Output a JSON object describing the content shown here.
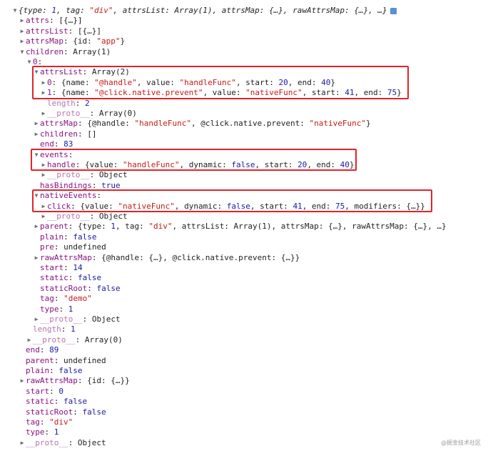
{
  "rows": [
    {
      "d": 0,
      "t": "d",
      "p": [
        {
          "c": "o it",
          "v": "{type: "
        },
        {
          "c": "n it",
          "v": "1"
        },
        {
          "c": "o it",
          "v": ", tag: "
        },
        {
          "c": "s it",
          "v": "\"div\""
        },
        {
          "c": "o it",
          "v": ", attrsList: Array(1), attrsMap: {…}, rawAttrsMap: {…}, …}"
        }
      ],
      "badge": true
    },
    {
      "d": 1,
      "t": "r",
      "p": [
        {
          "c": "k",
          "v": "attrs"
        },
        {
          "c": "p",
          "v": ": [{…}]"
        }
      ]
    },
    {
      "d": 1,
      "t": "r",
      "p": [
        {
          "c": "k",
          "v": "attrsList"
        },
        {
          "c": "p",
          "v": ": [{…}]"
        }
      ]
    },
    {
      "d": 1,
      "t": "r",
      "p": [
        {
          "c": "k",
          "v": "attrsMap"
        },
        {
          "c": "p",
          "v": ": {id: "
        },
        {
          "c": "s",
          "v": "\"app\""
        },
        {
          "c": "p",
          "v": "}"
        }
      ]
    },
    {
      "d": 1,
      "t": "d",
      "p": [
        {
          "c": "k",
          "v": "children"
        },
        {
          "c": "p",
          "v": ": Array(1)"
        }
      ]
    },
    {
      "d": 2,
      "t": "d",
      "p": [
        {
          "c": "k",
          "v": "0"
        },
        {
          "c": "p",
          "v": ":"
        }
      ]
    },
    {
      "d": 3,
      "t": "d",
      "p": [
        {
          "c": "k",
          "v": "attrsList"
        },
        {
          "c": "p",
          "v": ": Array(2)"
        }
      ]
    },
    {
      "d": 4,
      "t": "r",
      "p": [
        {
          "c": "k",
          "v": "0"
        },
        {
          "c": "p",
          "v": ": {name: "
        },
        {
          "c": "s",
          "v": "\"@handle\""
        },
        {
          "c": "p",
          "v": ", value: "
        },
        {
          "c": "s",
          "v": "\"handleFunc\""
        },
        {
          "c": "p",
          "v": ", start: "
        },
        {
          "c": "n",
          "v": "20"
        },
        {
          "c": "p",
          "v": ", end: "
        },
        {
          "c": "n",
          "v": "40"
        },
        {
          "c": "p",
          "v": "}"
        }
      ]
    },
    {
      "d": 4,
      "t": "r",
      "p": [
        {
          "c": "k",
          "v": "1"
        },
        {
          "c": "p",
          "v": ": {name: "
        },
        {
          "c": "s",
          "v": "\"@click.native.prevent\""
        },
        {
          "c": "p",
          "v": ", value: "
        },
        {
          "c": "s",
          "v": "\"nativeFunc\""
        },
        {
          "c": "p",
          "v": ", start: "
        },
        {
          "c": "n",
          "v": "41"
        },
        {
          "c": "p",
          "v": ", end: "
        },
        {
          "c": "n",
          "v": "75"
        },
        {
          "c": "p",
          "v": "}"
        }
      ]
    },
    {
      "d": 4,
      "t": "n",
      "p": [
        {
          "c": "k dim",
          "v": "length"
        },
        {
          "c": "p",
          "v": ": "
        },
        {
          "c": "n",
          "v": "2"
        }
      ]
    },
    {
      "d": 4,
      "t": "r",
      "p": [
        {
          "c": "k dim",
          "v": "__proto__"
        },
        {
          "c": "p",
          "v": ": Array(0)"
        }
      ]
    },
    {
      "d": 3,
      "t": "r",
      "p": [
        {
          "c": "k",
          "v": "attrsMap"
        },
        {
          "c": "p",
          "v": ": {@handle: "
        },
        {
          "c": "s",
          "v": "\"handleFunc\""
        },
        {
          "c": "p",
          "v": ", @click.native.prevent: "
        },
        {
          "c": "s",
          "v": "\"nativeFunc\""
        },
        {
          "c": "p",
          "v": "}"
        }
      ]
    },
    {
      "d": 3,
      "t": "r",
      "p": [
        {
          "c": "k",
          "v": "children"
        },
        {
          "c": "p",
          "v": ": []"
        }
      ]
    },
    {
      "d": 3,
      "t": "n",
      "p": [
        {
          "c": "k",
          "v": "end"
        },
        {
          "c": "p",
          "v": ": "
        },
        {
          "c": "n",
          "v": "83"
        }
      ]
    },
    {
      "d": 3,
      "t": "d",
      "p": [
        {
          "c": "k",
          "v": "events"
        },
        {
          "c": "p",
          "v": ":"
        }
      ]
    },
    {
      "d": 4,
      "t": "r",
      "p": [
        {
          "c": "k",
          "v": "handle"
        },
        {
          "c": "p",
          "v": ": {value: "
        },
        {
          "c": "s",
          "v": "\"handleFunc\""
        },
        {
          "c": "p",
          "v": ", dynamic: "
        },
        {
          "c": "n",
          "v": "false"
        },
        {
          "c": "p",
          "v": ", start: "
        },
        {
          "c": "n",
          "v": "20"
        },
        {
          "c": "p",
          "v": ", end: "
        },
        {
          "c": "n",
          "v": "40"
        },
        {
          "c": "p",
          "v": "}"
        }
      ]
    },
    {
      "d": 4,
      "t": "r",
      "p": [
        {
          "c": "k dim",
          "v": "__proto__"
        },
        {
          "c": "p",
          "v": ": Object"
        }
      ]
    },
    {
      "d": 3,
      "t": "n",
      "p": [
        {
          "c": "k",
          "v": "hasBindings"
        },
        {
          "c": "p",
          "v": ": "
        },
        {
          "c": "n",
          "v": "true"
        }
      ]
    },
    {
      "d": 3,
      "t": "d",
      "p": [
        {
          "c": "k",
          "v": "nativeEvents"
        },
        {
          "c": "p",
          "v": ":"
        }
      ]
    },
    {
      "d": 4,
      "t": "r",
      "p": [
        {
          "c": "k",
          "v": "click"
        },
        {
          "c": "p",
          "v": ": {value: "
        },
        {
          "c": "s",
          "v": "\"nativeFunc\""
        },
        {
          "c": "p",
          "v": ", dynamic: "
        },
        {
          "c": "n",
          "v": "false"
        },
        {
          "c": "p",
          "v": ", start: "
        },
        {
          "c": "n",
          "v": "41"
        },
        {
          "c": "p",
          "v": ", end: "
        },
        {
          "c": "n",
          "v": "75"
        },
        {
          "c": "p",
          "v": ", modifiers: {…}}"
        }
      ]
    },
    {
      "d": 4,
      "t": "r",
      "p": [
        {
          "c": "k dim",
          "v": "__proto__"
        },
        {
          "c": "p",
          "v": ": Object"
        }
      ]
    },
    {
      "d": 3,
      "t": "r",
      "p": [
        {
          "c": "k",
          "v": "parent"
        },
        {
          "c": "p",
          "v": ": {type: "
        },
        {
          "c": "n",
          "v": "1"
        },
        {
          "c": "p",
          "v": ", tag: "
        },
        {
          "c": "s",
          "v": "\"div\""
        },
        {
          "c": "p",
          "v": ", attrsList: Array(1), attrsMap: {…}, rawAttrsMap: {…}, …}"
        }
      ]
    },
    {
      "d": 3,
      "t": "n",
      "p": [
        {
          "c": "k",
          "v": "plain"
        },
        {
          "c": "p",
          "v": ": "
        },
        {
          "c": "n",
          "v": "false"
        }
      ]
    },
    {
      "d": 3,
      "t": "n",
      "p": [
        {
          "c": "k",
          "v": "pre"
        },
        {
          "c": "p",
          "v": ": undefined"
        }
      ]
    },
    {
      "d": 3,
      "t": "r",
      "p": [
        {
          "c": "k",
          "v": "rawAttrsMap"
        },
        {
          "c": "p",
          "v": ": {@handle: {…}, @click.native.prevent: {…}}"
        }
      ]
    },
    {
      "d": 3,
      "t": "n",
      "p": [
        {
          "c": "k",
          "v": "start"
        },
        {
          "c": "p",
          "v": ": "
        },
        {
          "c": "n",
          "v": "14"
        }
      ]
    },
    {
      "d": 3,
      "t": "n",
      "p": [
        {
          "c": "k",
          "v": "static"
        },
        {
          "c": "p",
          "v": ": "
        },
        {
          "c": "n",
          "v": "false"
        }
      ]
    },
    {
      "d": 3,
      "t": "n",
      "p": [
        {
          "c": "k",
          "v": "staticRoot"
        },
        {
          "c": "p",
          "v": ": "
        },
        {
          "c": "n",
          "v": "false"
        }
      ]
    },
    {
      "d": 3,
      "t": "n",
      "p": [
        {
          "c": "k",
          "v": "tag"
        },
        {
          "c": "p",
          "v": ": "
        },
        {
          "c": "s",
          "v": "\"demo\""
        }
      ]
    },
    {
      "d": 3,
      "t": "n",
      "p": [
        {
          "c": "k",
          "v": "type"
        },
        {
          "c": "p",
          "v": ": "
        },
        {
          "c": "n",
          "v": "1"
        }
      ]
    },
    {
      "d": 3,
      "t": "r",
      "p": [
        {
          "c": "k dim",
          "v": "__proto__"
        },
        {
          "c": "p",
          "v": ": Object"
        }
      ]
    },
    {
      "d": 2,
      "t": "n",
      "p": [
        {
          "c": "k dim",
          "v": "length"
        },
        {
          "c": "p",
          "v": ": "
        },
        {
          "c": "n",
          "v": "1"
        }
      ]
    },
    {
      "d": 2,
      "t": "r",
      "p": [
        {
          "c": "k dim",
          "v": "__proto__"
        },
        {
          "c": "p",
          "v": ": Array(0)"
        }
      ]
    },
    {
      "d": 1,
      "t": "n",
      "p": [
        {
          "c": "k",
          "v": "end"
        },
        {
          "c": "p",
          "v": ": "
        },
        {
          "c": "n",
          "v": "89"
        }
      ]
    },
    {
      "d": 1,
      "t": "n",
      "p": [
        {
          "c": "k",
          "v": "parent"
        },
        {
          "c": "p",
          "v": ": undefined"
        }
      ]
    },
    {
      "d": 1,
      "t": "n",
      "p": [
        {
          "c": "k",
          "v": "plain"
        },
        {
          "c": "p",
          "v": ": "
        },
        {
          "c": "n",
          "v": "false"
        }
      ]
    },
    {
      "d": 1,
      "t": "r",
      "p": [
        {
          "c": "k",
          "v": "rawAttrsMap"
        },
        {
          "c": "p",
          "v": ": {id: {…}}"
        }
      ]
    },
    {
      "d": 1,
      "t": "n",
      "p": [
        {
          "c": "k",
          "v": "start"
        },
        {
          "c": "p",
          "v": ": "
        },
        {
          "c": "n",
          "v": "0"
        }
      ]
    },
    {
      "d": 1,
      "t": "n",
      "p": [
        {
          "c": "k",
          "v": "static"
        },
        {
          "c": "p",
          "v": ": "
        },
        {
          "c": "n",
          "v": "false"
        }
      ]
    },
    {
      "d": 1,
      "t": "n",
      "p": [
        {
          "c": "k",
          "v": "staticRoot"
        },
        {
          "c": "p",
          "v": ": "
        },
        {
          "c": "n",
          "v": "false"
        }
      ]
    },
    {
      "d": 1,
      "t": "n",
      "p": [
        {
          "c": "k",
          "v": "tag"
        },
        {
          "c": "p",
          "v": ": "
        },
        {
          "c": "s",
          "v": "\"div\""
        }
      ]
    },
    {
      "d": 1,
      "t": "n",
      "p": [
        {
          "c": "k",
          "v": "type"
        },
        {
          "c": "p",
          "v": ": "
        },
        {
          "c": "n",
          "v": "1"
        }
      ]
    },
    {
      "d": 1,
      "t": "r",
      "p": [
        {
          "c": "k dim",
          "v": "__proto__"
        },
        {
          "c": "p",
          "v": ": Object"
        }
      ]
    }
  ],
  "highlights": [
    {
      "name": "attrslist-highlight",
      "rows": [
        6,
        8
      ]
    },
    {
      "name": "events-highlight",
      "rows": [
        14,
        15
      ]
    },
    {
      "name": "native-events-highlight",
      "rows": [
        18,
        19
      ]
    }
  ],
  "colors": {
    "key": "#881280",
    "string": "#c41a16",
    "number": "#1a1aa6",
    "highlight": "#e0242a"
  },
  "icons": {
    "expanded": "triangle-down-icon",
    "collapsed": "triangle-right-icon"
  },
  "watermark": "@掘金技术社区"
}
